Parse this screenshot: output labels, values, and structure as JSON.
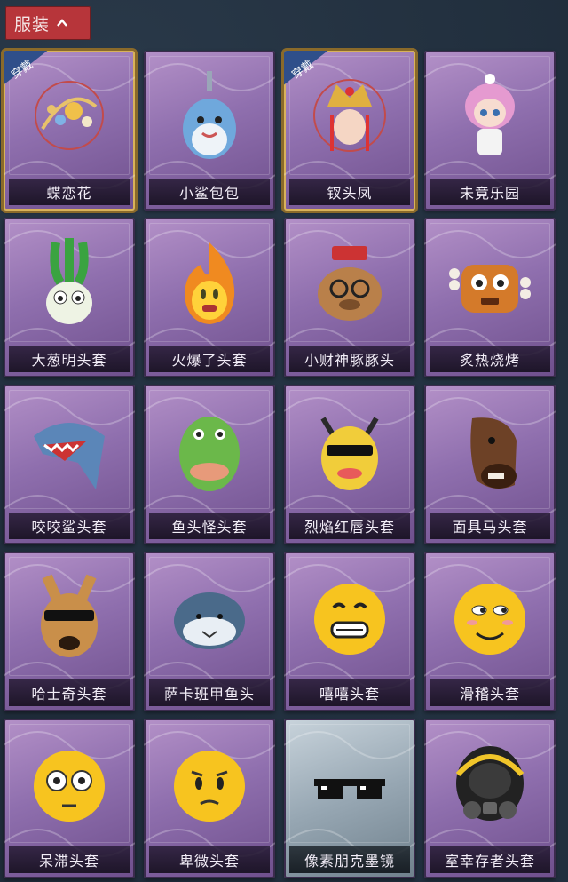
{
  "header": {
    "category_label": "服装",
    "toggle_icon": "chevron-up-icon"
  },
  "badge_text": "穿戴",
  "items": [
    {
      "name": "蝶恋花",
      "equipped": true,
      "kind": "hair-ornament"
    },
    {
      "name": "小鲨包包",
      "equipped": false,
      "kind": "shark-bag"
    },
    {
      "name": "钗头凤",
      "equipped": true,
      "kind": "phoenix-crown"
    },
    {
      "name": "未竟乐园",
      "equipped": false,
      "kind": "doll"
    },
    {
      "name": "大葱明头套",
      "equipped": false,
      "kind": "scallion-mask"
    },
    {
      "name": "火爆了头套",
      "equipped": false,
      "kind": "fire-mask"
    },
    {
      "name": "小财神豚豚头",
      "equipped": false,
      "kind": "capybara-mask"
    },
    {
      "name": "炙热烧烤",
      "equipped": false,
      "kind": "bbq-mask"
    },
    {
      "name": "咬咬鲨头套",
      "equipped": false,
      "kind": "shark-mask"
    },
    {
      "name": "鱼头怪头套",
      "equipped": false,
      "kind": "fish-mask"
    },
    {
      "name": "烈焰红唇头套",
      "equipped": false,
      "kind": "pikachu-mask"
    },
    {
      "name": "面具马头套",
      "equipped": false,
      "kind": "horse-mask"
    },
    {
      "name": "哈士奇头套",
      "equipped": false,
      "kind": "husky-mask"
    },
    {
      "name": "萨卡班甲鱼头",
      "equipped": false,
      "kind": "sacabambaspis-mask"
    },
    {
      "name": "嘻嘻头套",
      "equipped": false,
      "kind": "grin-emoji-mask"
    },
    {
      "name": "滑稽头套",
      "equipped": false,
      "kind": "smirk-emoji-mask"
    },
    {
      "name": "呆滞头套",
      "equipped": false,
      "kind": "stunned-emoji-mask"
    },
    {
      "name": "卑微头套",
      "equipped": false,
      "kind": "humble-emoji-mask"
    },
    {
      "name": "像素朋克墨镜",
      "equipped": false,
      "kind": "pixel-sunglasses",
      "rarity": "silver"
    },
    {
      "name": "室幸存者头套",
      "equipped": false,
      "kind": "gas-mask-helmet"
    }
  ]
}
